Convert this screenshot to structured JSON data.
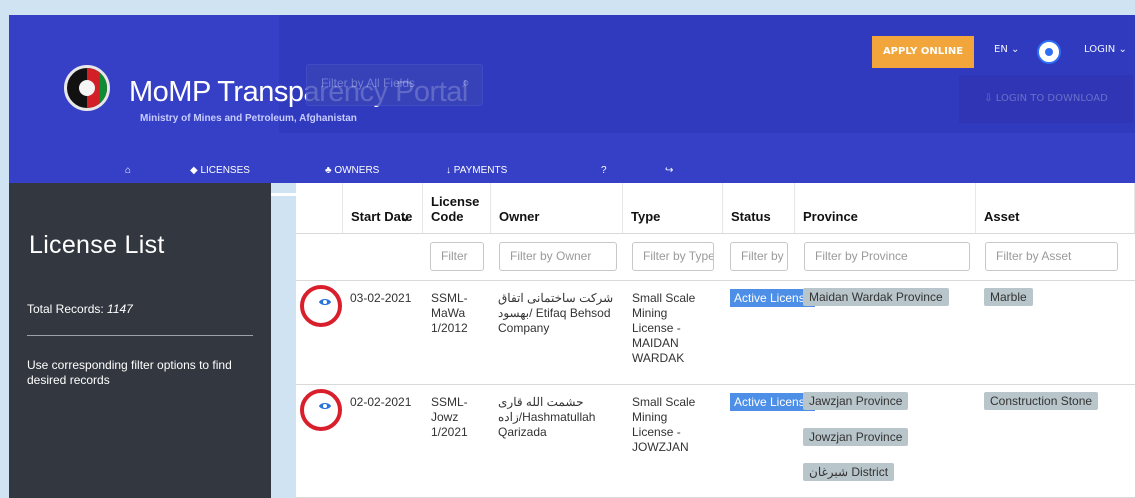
{
  "brand": {
    "title": "MoMP Transparency Portal",
    "subtitle": "Ministry of Mines and Petroleum, Afghanistan"
  },
  "header": {
    "search_placeholder": "Filter by All Fields",
    "apply_online": "APPLY ONLINE",
    "language": "EN",
    "login": "LOGIN",
    "login_to_download": "LOGIN TO DOWNLOAD"
  },
  "nav": {
    "items": [
      {
        "label": "",
        "icon": "home-icon"
      },
      {
        "label": "LICENSES",
        "icon": "licenses-icon"
      },
      {
        "label": "OWNERS",
        "icon": "owners-icon"
      },
      {
        "label": "PAYMENTS",
        "icon": "payments-icon"
      },
      {
        "label": "",
        "icon": "help-icon"
      },
      {
        "label": "",
        "icon": "signin-icon"
      }
    ]
  },
  "sidebar": {
    "title": "License List",
    "total_label": "Total Records: ",
    "total_value": "1147",
    "help": "Use corresponding filter options to find desired records"
  },
  "table": {
    "headers": [
      "Start Date",
      "License Code",
      "Owner",
      "Type",
      "Status",
      "Province",
      "Asset"
    ],
    "filters": [
      "Filter",
      "Filter by Owner",
      "Filter by Type",
      "Filter by",
      "Filter by Province",
      "Filter by Asset"
    ],
    "rows": [
      {
        "start_date": "03-02-2021",
        "license_code": "SSML-\nMaWa\n1/2012",
        "owner": "شرکت ساختمانی اتفاق\nبهسود/ Etifaq Behsod\nCompany",
        "type": "Small Scale\nMining\nLicense -\nMAIDAN\nWARDAK",
        "status": "Active\nLicense",
        "province": [
          "Maidan Wardak Province"
        ],
        "asset": "Marble"
      },
      {
        "start_date": "02-02-2021",
        "license_code": "SSML-\nJowz\n1/2021",
        "owner": "حشمت الله قاری\nزاده/Hashmatullah\nQarizada",
        "type": "Small Scale\nMining\nLicense -\nJOWZJAN",
        "status": "Active\nLicense",
        "province": [
          "Jawzjan Province",
          "Jowzjan Province",
          "شبرغان District"
        ],
        "asset": "Construction Stone"
      }
    ]
  },
  "colors": {
    "header": "#3640c7",
    "sidebar": "#333840",
    "apply": "#f2a53a",
    "status": "#4d8ee6",
    "pill": "#b8c6cc",
    "highlight": "#d81f2b"
  }
}
